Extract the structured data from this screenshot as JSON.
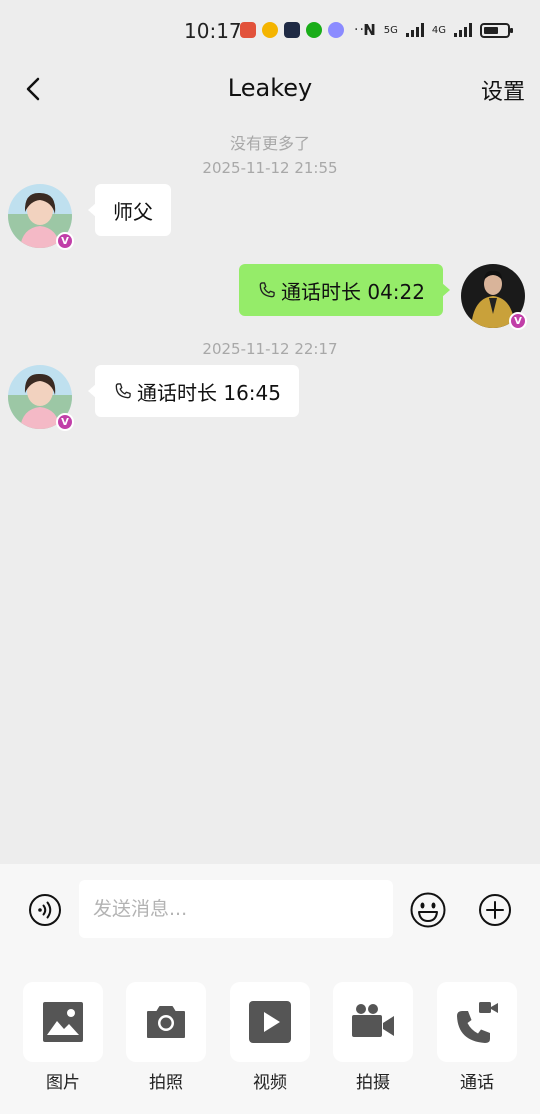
{
  "status_bar": {
    "time": "10:17",
    "network_label_1": "5G",
    "network_label_2": "4G",
    "overflow": "···"
  },
  "header": {
    "title": "Leakey",
    "settings_label": "设置"
  },
  "chat": {
    "no_more_label": "没有更多了",
    "timestamps": [
      "2025-11-12 21:55",
      "2025-11-12 22:17"
    ],
    "messages": [
      {
        "side": "left",
        "text": "师父"
      },
      {
        "side": "right",
        "text": "通话时长 04:22",
        "icon": "phone-icon"
      },
      {
        "side": "left",
        "text": "通话时长 16:45",
        "icon": "phone-icon"
      }
    ],
    "badge_letter": "V"
  },
  "input_bar": {
    "placeholder": "发送消息..."
  },
  "tools": [
    {
      "label": "图片",
      "icon": "image-icon"
    },
    {
      "label": "拍照",
      "icon": "camera-icon"
    },
    {
      "label": "视频",
      "icon": "video-play-icon"
    },
    {
      "label": "拍摄",
      "icon": "video-camera-icon"
    },
    {
      "label": "通话",
      "icon": "video-call-icon"
    }
  ],
  "colors": {
    "background": "#ededed",
    "bubble_self": "#95ec69",
    "bubble_other": "#ffffff",
    "badge": "#c13fa8",
    "tool_icon": "#555555"
  }
}
